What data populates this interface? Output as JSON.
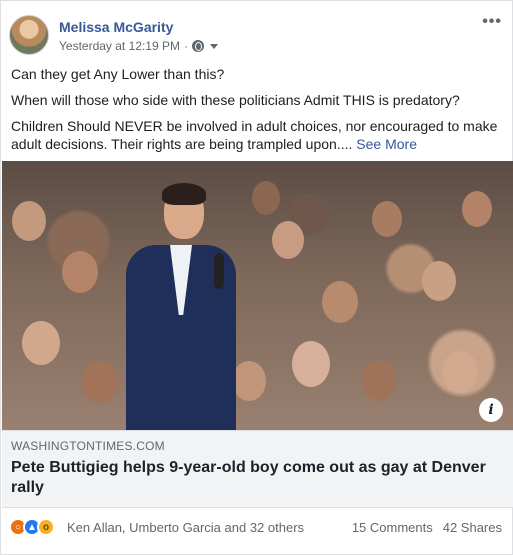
{
  "post": {
    "author": "Melissa McGarity",
    "timestamp": "Yesterday at 12:19 PM",
    "separator": "·",
    "more_menu": "•••",
    "paragraphs": [
      "Can they get Any Lower than this?",
      "When will those who side with these politicians Admit THIS is predatory?",
      "Children Should NEVER be involved in adult choices, nor encouraged to make adult decisions. Their rights are being trampled upon...."
    ],
    "see_more": "See More"
  },
  "link": {
    "domain": "WASHINGTONTIMES.COM",
    "headline": "Pete Buttigieg helps 9-year-old boy come out as gay at Denver rally",
    "info_icon": "i"
  },
  "footer": {
    "reaction_icons": [
      "angry-icon",
      "like-icon",
      "wow-icon"
    ],
    "reactors": "Ken Allan, Umberto Garcia and 32 others",
    "comments": "15 Comments",
    "shares": "42 Shares"
  },
  "colors": {
    "link_blue": "#385898",
    "secondary_text": "#606770",
    "angry": "#e9710f",
    "like": "#2078f4",
    "wow": "#f7b125"
  }
}
